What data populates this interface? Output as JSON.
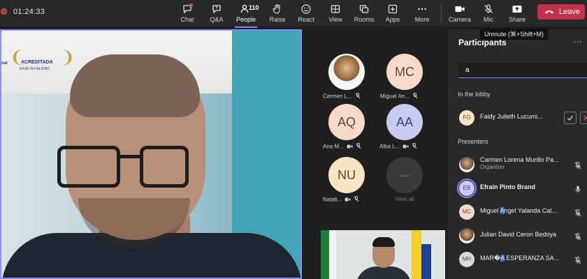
{
  "meeting": {
    "timer": "01:24:33"
  },
  "toolbar": {
    "chat": "Chat",
    "qa": "Q&A",
    "people": "People",
    "people_count": "110",
    "raise": "Raise",
    "react": "React",
    "view": "View",
    "rooms": "Rooms",
    "apps": "Apps",
    "more": "More",
    "camera": "Camera",
    "mic": "Mic",
    "share": "Share",
    "leave": "Leave"
  },
  "tooltip": {
    "mic": "Unmute (⌘+Shift+M)"
  },
  "main_video": {
    "banner_text_1": "ACREDITADA",
    "banner_text_2": "EN ALTA CALIDAD",
    "banner_text_3": "nal"
  },
  "gallery": {
    "tiles": [
      {
        "name": "Carmen L...",
        "initials": ""
      },
      {
        "name": "Miguel An...",
        "initials": "MC"
      },
      {
        "name": "Ana M...",
        "initials": "AQ"
      },
      {
        "name": "Alba L...",
        "initials": "AA"
      },
      {
        "name": "Natali...",
        "initials": "NU"
      },
      {
        "name": "View all",
        "initials": "···"
      }
    ]
  },
  "participants": {
    "title": "Participants",
    "more": "···",
    "search_value": "a",
    "lobby_heading": "In the lobby",
    "presenters_heading": "Presenters",
    "lobby": [
      {
        "initials": "FO",
        "name": "Faidy Julieth Lucumi..."
      }
    ],
    "presenters": [
      {
        "initials": "",
        "name": "Carmen Lorena Murillo Pa...",
        "role": "Organizer"
      },
      {
        "initials": "EB",
        "name": "Efrain Pinto Brand"
      },
      {
        "initials": "MC",
        "name_pre": "Miguel ",
        "name_hl": "A",
        "name_post": "ngel Yalanda Cal..."
      },
      {
        "initials": "",
        "name": "Julian David Ceron Bedoya"
      },
      {
        "initials": "MH",
        "name_pre": "MAR�",
        "name_hl": "A",
        "name_post": " ESPERANZA SA..."
      }
    ]
  },
  "colors": {
    "accent": "#7f85f5",
    "leave": "#c4314b",
    "background": "#1f1f1f",
    "panel": "#292929"
  },
  "icons": {
    "chat": "chat-icon",
    "qa": "qa-icon",
    "people": "people-icon",
    "raise": "hand-icon",
    "react": "smile-icon",
    "view": "view-icon",
    "rooms": "rooms-icon",
    "apps": "apps-icon",
    "more": "ellipsis-icon",
    "camera": "camera-icon",
    "mic": "mic-off-icon",
    "share": "share-icon",
    "leave": "phone-icon"
  }
}
